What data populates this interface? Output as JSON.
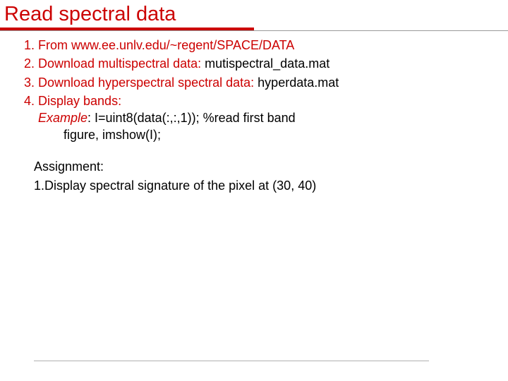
{
  "title": "Read spectral data",
  "list": {
    "item1": {
      "text": "From www.ee.unlv.edu/~regent/SPACE/DATA"
    },
    "item2": {
      "lead": "Download multispectral data: ",
      "rest": "mutispectral_data.mat"
    },
    "item3": {
      "lead": "Download hyperspectral spectral data: ",
      "rest": "hyperdata.mat"
    },
    "item4": {
      "lead": "Display bands:",
      "example_label": "Example",
      "example_code": ": I=uint8(data(:,:,1)); %read first band",
      "figure": "figure, imshow(I);"
    }
  },
  "assignment": {
    "heading": "Assignment:",
    "item1": "1.Display  spectral signature of the pixel at  (30, 40)"
  }
}
